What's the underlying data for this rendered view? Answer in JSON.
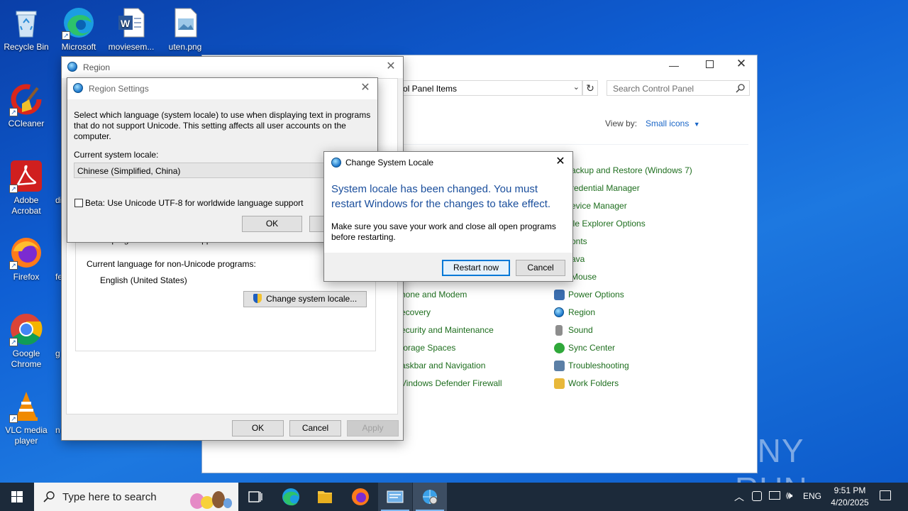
{
  "desktop": {
    "icons": [
      {
        "label": "Recycle Bin",
        "icon": "recycle-bin-icon"
      },
      {
        "label": "Microsoft Edge",
        "icon": "edge-icon"
      },
      {
        "label": "moviesem...",
        "icon": "word-doc-icon"
      },
      {
        "label": "uten.png",
        "icon": "image-file-icon"
      },
      {
        "label": "CCleaner",
        "icon": "ccleaner-icon"
      },
      {
        "label": "Adobe Acrobat",
        "icon": "acrobat-icon"
      },
      {
        "label": "Firefox",
        "icon": "firefox-icon"
      },
      {
        "label": "Google Chrome",
        "icon": "chrome-icon"
      },
      {
        "label": "VLC media player",
        "icon": "vlc-icon"
      }
    ],
    "partial_labels": [
      "di",
      "fe",
      "g",
      "n"
    ]
  },
  "control_panel": {
    "address": "rol Panel Items",
    "search_placeholder": "Search Control Panel",
    "view_by_label": "View by:",
    "view_by_value": "Small icons",
    "items_col1": [
      "hone and Modem",
      "ecovery",
      "ecurity and Maintenance",
      "torage Spaces",
      "askbar and Navigation",
      "Vindows Defender Firewall"
    ],
    "items_col2_top": [
      "ackup and Restore (Windows 7)",
      "redential Manager",
      "evice Manager",
      "ile Explorer Options",
      "onts",
      "ava",
      "Mouse"
    ],
    "items_col2": [
      "Power Options",
      "Region",
      "Sound",
      "Sync Center",
      "Troubleshooting",
      "Work Folders"
    ]
  },
  "region": {
    "title": "Region",
    "partial_text": "text in programs that do not support Unicode.",
    "nonunicode_label": "Current language for non-Unicode programs:",
    "nonunicode_value": "English (United States)",
    "change_locale_button": "Change system locale...",
    "ok": "OK",
    "cancel": "Cancel",
    "apply": "Apply"
  },
  "region_settings": {
    "title": "Region Settings",
    "description": "Select which language (system locale) to use when displaying text in programs that do not support Unicode. This setting affects all user accounts on the computer.",
    "current_locale_label": "Current system locale:",
    "current_locale_value": "Chinese (Simplified, China)",
    "beta_checkbox_label": "Beta: Use Unicode UTF-8 for worldwide language support",
    "ok": "OK"
  },
  "change_locale_dialog": {
    "title": "Change System Locale",
    "heading": "System locale has been changed. You must restart Windows for the changes to take effect.",
    "body": "Make sure you save your work and close all open programs before restarting.",
    "restart_button": "Restart now",
    "cancel_button": "Cancel"
  },
  "taskbar": {
    "search_placeholder": "Type here to search",
    "language": "ENG",
    "time": "9:51 PM",
    "date": "4/20/2025"
  },
  "watermark": "ANY RUN",
  "colors": {
    "heading_blue": "#1a4e9c",
    "link_green": "#1e6e1e",
    "accent": "#0078d7"
  }
}
